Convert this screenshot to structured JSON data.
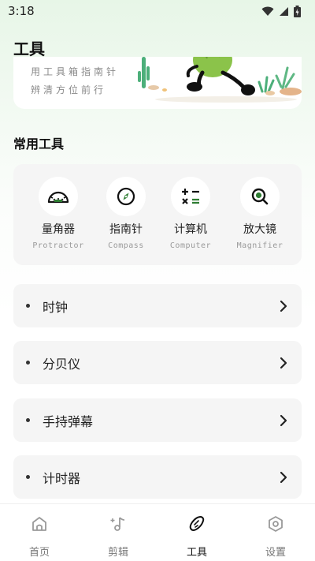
{
  "status_bar": {
    "time": "3:18"
  },
  "page": {
    "title": "工具"
  },
  "banner": {
    "line1": "用工具箱指南针",
    "line2": "辨清方位前行"
  },
  "common_tools": {
    "title": "常用工具",
    "items": [
      {
        "name": "量角器",
        "subtitle": "Protractor",
        "icon": "protractor-icon"
      },
      {
        "name": "指南针",
        "subtitle": "Compass",
        "icon": "compass-icon"
      },
      {
        "name": "计算机",
        "subtitle": "Computer",
        "icon": "calculator-icon"
      },
      {
        "name": "放大镜",
        "subtitle": "Magnifier",
        "icon": "magnifier-icon"
      }
    ]
  },
  "list": [
    {
      "label": "时钟"
    },
    {
      "label": "分贝仪"
    },
    {
      "label": "手持弹幕"
    },
    {
      "label": "计时器"
    }
  ],
  "nav": [
    {
      "label": "首页",
      "icon": "home-icon",
      "active": false
    },
    {
      "label": "剪辑",
      "icon": "music-note-icon",
      "active": false
    },
    {
      "label": "工具",
      "icon": "cucumber-icon",
      "active": true
    },
    {
      "label": "设置",
      "icon": "settings-hexagon-icon",
      "active": false
    }
  ],
  "colors": {
    "accent_green": "#2e7d32",
    "background_tint": "#e7f6e7"
  }
}
